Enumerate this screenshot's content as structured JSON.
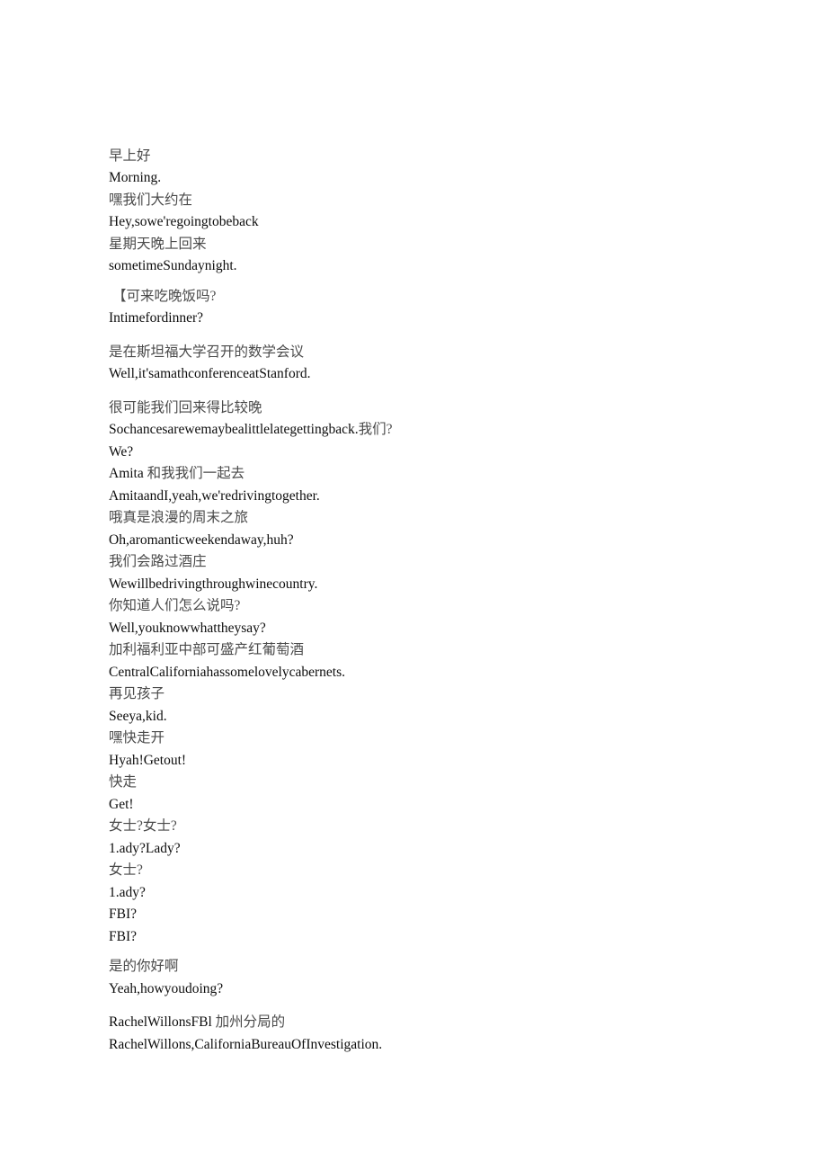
{
  "document": {
    "type": "bilingual-subtitle-transcript",
    "background_color": "#ffffff",
    "chinese_text_color": "#4a4a4a",
    "english_text_color": "#0d0d0d",
    "lines": [
      {
        "id": "l01",
        "lang": "zh",
        "text": "早上好"
      },
      {
        "id": "l02",
        "lang": "en",
        "text": "Morning."
      },
      {
        "id": "l03",
        "lang": "zh",
        "text": "嘿我们大约在"
      },
      {
        "id": "l04",
        "lang": "en",
        "text": "Hey,sowe'regoingtobeback"
      },
      {
        "id": "l05",
        "lang": "zh",
        "text": "星期天晚上回来"
      },
      {
        "id": "l06",
        "lang": "en",
        "text": "sometimeSundaynight."
      },
      {
        "id": "l07",
        "lang": "zh",
        "text": "【可来吃晚饭吗?"
      },
      {
        "id": "l08",
        "lang": "en",
        "text": "Intimefordinner?"
      },
      {
        "id": "l09",
        "lang": "zh",
        "text": "是在斯坦福大学召开的数学会议"
      },
      {
        "id": "l10",
        "lang": "en",
        "text": "Well,it'samathconferenceatStanford."
      },
      {
        "id": "l11",
        "lang": "zh",
        "text": "很可能我们回来得比较晚"
      },
      {
        "id": "l12",
        "lang": "mixed",
        "segments": [
          {
            "lang": "en",
            "text": "Sochancesarewemaybealittlelategettingback."
          },
          {
            "lang": "zh",
            "text": "我们?"
          }
        ]
      },
      {
        "id": "l13",
        "lang": "en",
        "text": "We?"
      },
      {
        "id": "l14",
        "lang": "mixed",
        "segments": [
          {
            "lang": "en",
            "text": "Amita "
          },
          {
            "lang": "zh",
            "text": "和我我们一起去"
          }
        ]
      },
      {
        "id": "l15",
        "lang": "en",
        "text": "AmitaandI,yeah,we'redrivingtogether."
      },
      {
        "id": "l16",
        "lang": "zh",
        "text": "哦真是浪漫的周末之旅"
      },
      {
        "id": "l17",
        "lang": "en",
        "text": "Oh,aromanticweekendaway,huh?"
      },
      {
        "id": "l18",
        "lang": "zh",
        "text": "我们会路过酒庄"
      },
      {
        "id": "l19",
        "lang": "en",
        "text": "Wewillbedrivingthroughwinecountry."
      },
      {
        "id": "l20",
        "lang": "zh",
        "text": "你知道人们怎么说吗?"
      },
      {
        "id": "l21",
        "lang": "en",
        "text": "Well,youknowwhattheysay?"
      },
      {
        "id": "l22",
        "lang": "zh",
        "text": "加利福利亚中部可盛产红葡萄酒"
      },
      {
        "id": "l23",
        "lang": "en",
        "text": "CentralCaliforniahassomelovelycabernets."
      },
      {
        "id": "l24",
        "lang": "zh",
        "text": "再见孩子"
      },
      {
        "id": "l25",
        "lang": "en",
        "text": "Seeya,kid."
      },
      {
        "id": "l26",
        "lang": "zh",
        "text": "嘿快走开"
      },
      {
        "id": "l27",
        "lang": "en",
        "text": "Hyah!Getout!"
      },
      {
        "id": "l28",
        "lang": "zh",
        "text": "快走"
      },
      {
        "id": "l29",
        "lang": "en",
        "text": "Get!"
      },
      {
        "id": "l30",
        "lang": "zh",
        "text": "女士?女士?"
      },
      {
        "id": "l31",
        "lang": "en",
        "text": "1.ady?Lady?"
      },
      {
        "id": "l32",
        "lang": "zh",
        "text": "女士?"
      },
      {
        "id": "l33",
        "lang": "en",
        "text": "1.ady?"
      },
      {
        "id": "l34",
        "lang": "en",
        "text": "FBI?"
      },
      {
        "id": "l35",
        "lang": "en",
        "text": "FBI?"
      },
      {
        "id": "l36",
        "lang": "zh",
        "text": "是的你好啊"
      },
      {
        "id": "l37",
        "lang": "en",
        "text": "Yeah,howyoudoing?"
      },
      {
        "id": "l38",
        "lang": "mixed",
        "segments": [
          {
            "lang": "en",
            "text": "RachelWillonsFBl "
          },
          {
            "lang": "zh",
            "text": "加州分局的"
          }
        ]
      },
      {
        "id": "l39",
        "lang": "en",
        "text": "RachelWillons,CaliforniaBureauOfInvestigation."
      }
    ]
  }
}
